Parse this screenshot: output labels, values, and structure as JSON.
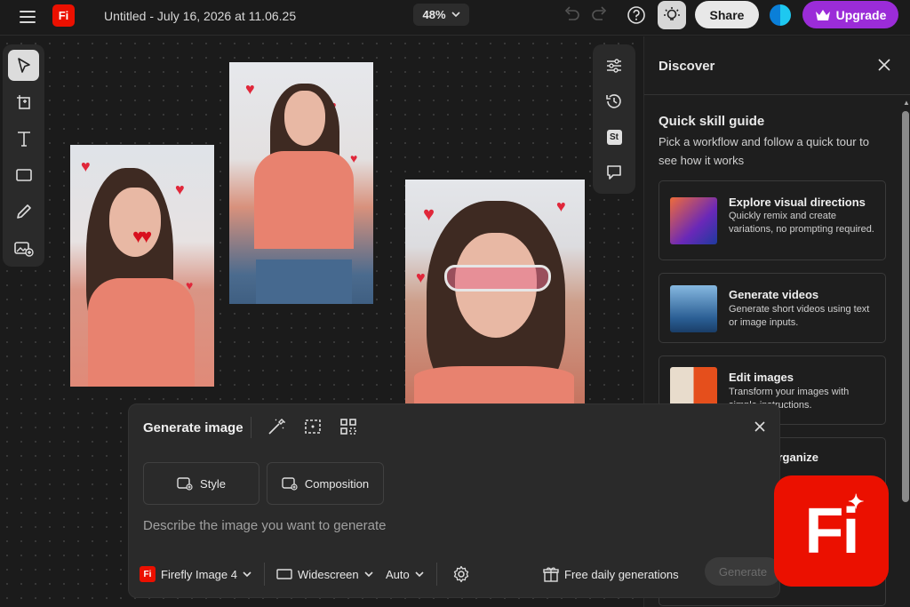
{
  "topbar": {
    "app_logo": "Fi",
    "doc_title": "Untitled - July 16, 2026 at 11.06.25",
    "zoom": "48%",
    "share_label": "Share",
    "upgrade_label": "Upgrade"
  },
  "left_tools": [
    "select-icon",
    "artboard-icon",
    "text-icon",
    "shape-icon",
    "pencil-icon",
    "add-image-icon"
  ],
  "right_tools": [
    "adjust-icon",
    "history-icon",
    "stock-icon",
    "comment-icon"
  ],
  "right_tools_stock_label": "St",
  "discover": {
    "title": "Discover",
    "guide_title": "Quick skill guide",
    "guide_desc": "Pick a workflow and follow a quick tour to see how it works",
    "cards": [
      {
        "title": "Explore visual directions",
        "desc": "Quickly remix and create variations, no prompting required."
      },
      {
        "title": "Generate videos",
        "desc": "Generate short videos using text or image inputs."
      },
      {
        "title": "Edit images",
        "desc": "Transform your images with simple instructions."
      },
      {
        "title": "d organize",
        "desc": ""
      }
    ]
  },
  "generate": {
    "title": "Generate image",
    "style_label": "Style",
    "composition_label": "Composition",
    "prompt_placeholder": "Describe the image you want to generate",
    "model_label": "Firefly Image 4",
    "model_badge": "Fi",
    "aspect_label": "Widescreen",
    "auto_label": "Auto",
    "free_label": "Free daily generations",
    "generate_label": "Generate"
  },
  "badge": {
    "label": "Fi"
  },
  "colors": {
    "accent_red": "#eb1000",
    "upgrade_purple": "#9b2cd8"
  }
}
